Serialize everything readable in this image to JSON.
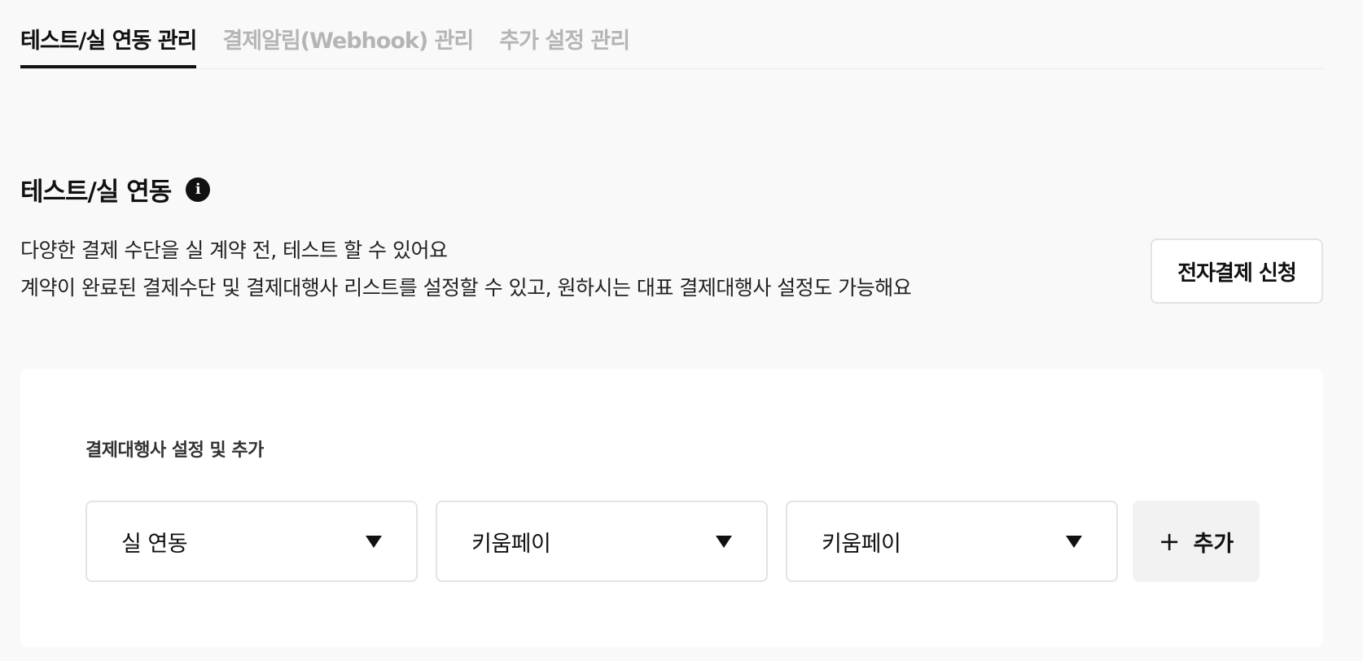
{
  "tabs": [
    {
      "label": "테스트/실 연동 관리",
      "active": true
    },
    {
      "label": "결제알림(Webhook) 관리",
      "active": false
    },
    {
      "label": "추가 설정 관리",
      "active": false
    }
  ],
  "section": {
    "title": "테스트/실 연동",
    "info_icon": "info-icon",
    "description": [
      "다양한 결제 수단을 실 계약 전, 테스트 할 수 있어요",
      "계약이 완료된 결제수단 및 결제대행사 리스트를 설정할 수 있고, 원하시는 대표 결제대행사 설정도 가능해요"
    ],
    "apply_button": "전자결제 신청"
  },
  "pg_settings": {
    "label": "결제대행사 설정 및 추가",
    "selects": [
      {
        "value": "실 연동"
      },
      {
        "value": "키움페이"
      },
      {
        "value": "키움페이"
      }
    ],
    "add_button": {
      "icon": "+",
      "label": "추가"
    }
  },
  "colors": {
    "background": "#f9f9f9",
    "text": "#111111",
    "inactive_tab": "#b5b5b5",
    "border": "#e3e3e3",
    "add_button_bg": "#f2f2f2"
  }
}
